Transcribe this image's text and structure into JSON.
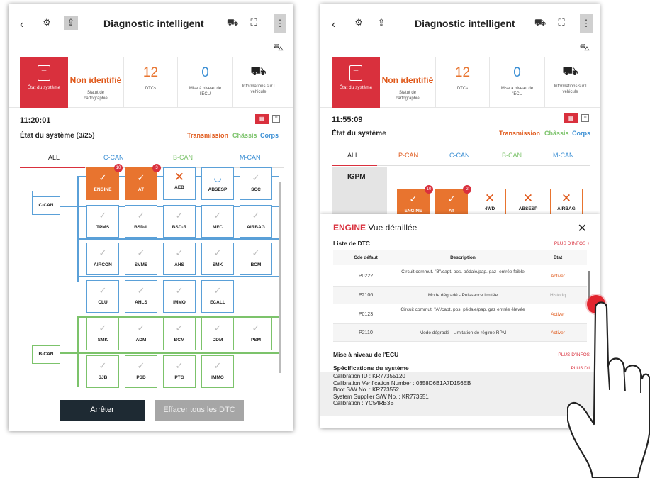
{
  "app_title": "Diagnostic intelligent",
  "summary": {
    "etat_label": "État du système",
    "carto_value": "Non identifié",
    "carto_label_1": "Statut de",
    "carto_label_2": "cartographie",
    "dtc_value": "12",
    "dtc_label": "DTCs",
    "ecu_value": "0",
    "ecu_label_1": "Mise à niveau de",
    "ecu_label_2": "l'ECU",
    "info_label_1": "Informations sur l",
    "info_label_2": "véhicule"
  },
  "screen1": {
    "time": "11:20:01",
    "etat": "État du système (3/25)",
    "cat_transmission": "Transmission",
    "cat_chassis": "Châssis",
    "cat_corps": "Corps",
    "tabs": [
      "ALL",
      "C-CAN",
      "B-CAN",
      "M-CAN"
    ],
    "bus_ccan": "C-CAN",
    "bus_bcan": "B-CAN",
    "nodes": [
      "ENGINE",
      "AT",
      "AEB",
      "ABSESP",
      "SCC",
      "TPMS",
      "BSD-L",
      "BSD-R",
      "MFC",
      "AIRBAG",
      "AIRCON",
      "SVMS",
      "AHS",
      "SMK",
      "BCM",
      "CLU",
      "AHLS",
      "IMMO",
      "ECALL",
      "SMK",
      "ADM",
      "BCM",
      "DDM",
      "PSM",
      "SJB",
      "PSD",
      "PTG",
      "IMMO"
    ],
    "badge_engine": "10",
    "badge_at": "3",
    "btn_stop": "Arrêter",
    "btn_clear": "Effacer tous les DTC"
  },
  "screen2": {
    "time": "11:55:09",
    "etat": "État du système",
    "cat_transmission": "Transmission",
    "cat_chassis": "Châssis",
    "cat_corps": "Corps",
    "tabs": [
      "ALL",
      "P-CAN",
      "C-CAN",
      "B-CAN",
      "M-CAN"
    ],
    "igpm": "IGPM",
    "nodes": [
      "ENGINE",
      "AT",
      "4WD",
      "ABSESP",
      "AIRBAG"
    ],
    "badge_engine": "10",
    "badge_at": "2",
    "panel_module": "ENGINE",
    "panel_title": "Vue détaillée",
    "dtc_list": "Liste de DTC",
    "plus": "PLUS D'INFOS +",
    "plus2": "PLUS D'INFOS",
    "plus3": "PLUS D'I",
    "col_code": "Cde défaut",
    "col_desc": "Description",
    "col_state": "État",
    "rows": [
      {
        "code": "P0222",
        "desc": "Circuit commut. \"B\"/capt. pos. pédale/pap. gaz- entrée faible",
        "state": "Activer"
      },
      {
        "code": "P2106",
        "desc": "Mode dégradé - Puissance limitée",
        "state": "Historiq"
      },
      {
        "code": "P0123",
        "desc": "Circuit commut. \"A\"/capt. pos. pédale/pap. gaz entrée élevée",
        "state": "Activer"
      },
      {
        "code": "P2110",
        "desc": "Mode dégradé - Limitation de régime RPM",
        "state": "Activer"
      }
    ],
    "ecu_upgrade": "Mise à niveau de l'ECU",
    "specs_title": "Spécifications du système",
    "specs": [
      "Calibration ID : KR77355120",
      "Calibration Verification Number : 0358D6B1A7D156EB",
      "Boot S/W No. : KR773552",
      "System Supplier S/W No. : KR773551",
      "Calibration : YC54RB3B"
    ]
  },
  "colors": {
    "accent": "#d9303d",
    "orange": "#e8742f",
    "ccan": "#5aa0d8",
    "bcan": "#7cc36b"
  }
}
